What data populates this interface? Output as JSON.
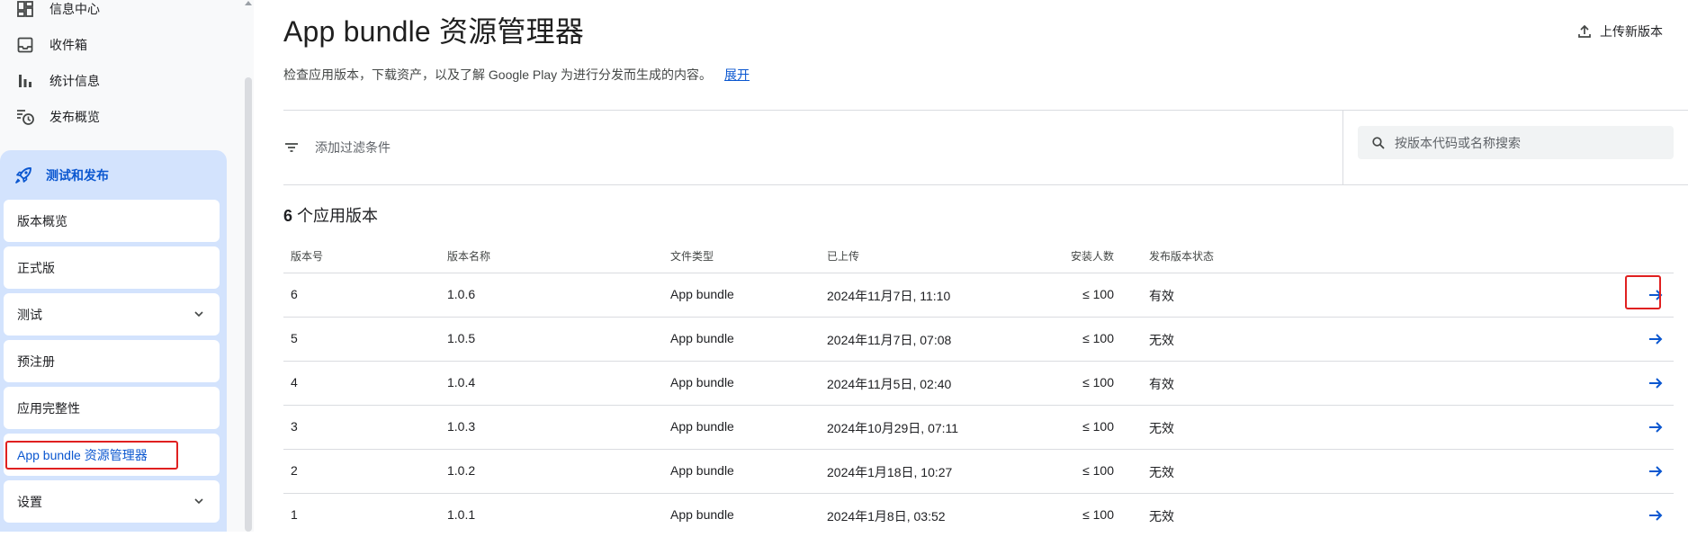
{
  "sidebar": {
    "top_items": [
      {
        "label": "信息中心",
        "icon": "dashboard-icon"
      },
      {
        "label": "收件箱",
        "icon": "inbox-icon"
      },
      {
        "label": "统计信息",
        "icon": "bar-chart-icon"
      },
      {
        "label": "发布概览",
        "icon": "publish-history-icon"
      }
    ],
    "group": {
      "label": "测试和发布",
      "icon": "rocket-icon",
      "items": [
        {
          "label": "版本概览"
        },
        {
          "label": "正式版"
        },
        {
          "label": "测试",
          "expandable": true
        },
        {
          "label": "预注册"
        },
        {
          "label": "应用完整性"
        },
        {
          "label": "App bundle 资源管理器",
          "active": true
        },
        {
          "label": "设置",
          "expandable": true
        }
      ]
    }
  },
  "header": {
    "title": "App bundle 资源管理器",
    "upload_label": "上传新版本",
    "description": "检查应用版本，下载资产，以及了解 Google Play 为进行分发而生成的内容。",
    "expand_link": "展开"
  },
  "filter": {
    "add_filter_label": "添加过滤条件",
    "search_placeholder": "按版本代码或名称搜索"
  },
  "summary": {
    "count": "6",
    "count_label": " 个应用版本"
  },
  "table": {
    "headers": [
      "版本号",
      "版本名称",
      "文件类型",
      "已上传",
      "安装人数",
      "发布版本状态"
    ],
    "rows": [
      [
        "6",
        "1.0.6",
        "App bundle",
        "2024年11月7日, 11:10",
        "≤ 100",
        "有效"
      ],
      [
        "5",
        "1.0.5",
        "App bundle",
        "2024年11月7日, 07:08",
        "≤ 100",
        "无效"
      ],
      [
        "4",
        "1.0.4",
        "App bundle",
        "2024年11月5日, 02:40",
        "≤ 100",
        "有效"
      ],
      [
        "3",
        "1.0.3",
        "App bundle",
        "2024年10月29日, 07:11",
        "≤ 100",
        "无效"
      ],
      [
        "2",
        "1.0.2",
        "App bundle",
        "2024年1月18日, 10:27",
        "≤ 100",
        "无效"
      ],
      [
        "1",
        "1.0.1",
        "App bundle",
        "2024年1月8日, 03:52",
        "≤ 100",
        "无效"
      ]
    ]
  },
  "colors": {
    "accent": "#0b57d0",
    "nav_group_bg": "#d3e3fd",
    "highlight": "#e02020"
  }
}
